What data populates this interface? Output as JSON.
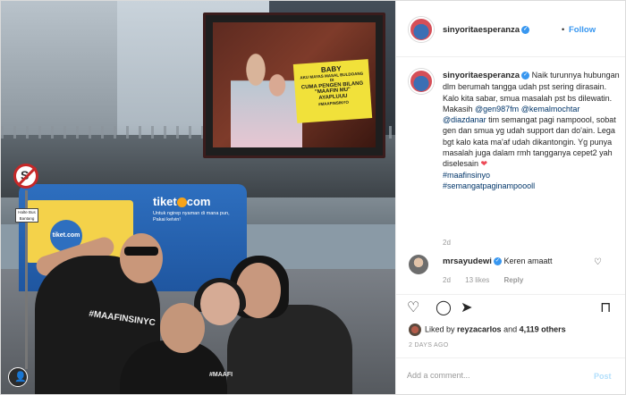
{
  "post": {
    "username": "sinyoritaesperanza",
    "follow_label": "Follow",
    "caption": {
      "text_1": "Naik turunnya hubungan dlm berumah tangga udah pst sering dirasain. Kalo kita sabar, smua masalah pst bs dilewatin. Makasih ",
      "mention_1": "@gen987fm",
      "mention_2": "@kemalmochtar",
      "mention_3": "@diazdanar",
      "text_2": " tim semangat pagi nampoool, sobat gen dan smua yg udah support dan do'ain. Lega bgt kalo kata ma'af udah dikantongin. Yg punya masalah juga dalam rmh tangganya cepet2 yah diselesain ",
      "hashtag_1": "#maafinsinyo",
      "hashtag_2": "#semangatpaginampoooll",
      "time": "2d"
    },
    "comment": {
      "username": "mrsayudewi",
      "text": "Keren amaatt",
      "time": "2d",
      "likes": "13 likes",
      "reply_label": "Reply"
    },
    "likes": {
      "prefix": "Liked by ",
      "user": "reyzacarlos",
      "middle": " and ",
      "count": "4,119 others"
    },
    "date": "2 DAYS AGO",
    "add_comment_placeholder": "Add a comment...",
    "post_label": "Post"
  },
  "photo": {
    "billboard_line_1": "BABY",
    "billboard_line_2": "AKU MAYAS MASAL BULDOANG DI",
    "billboard_line_3": "CUMA PENGEN BILANG",
    "billboard_line_4": "\"MAAFIN MU\"",
    "billboard_line_5": "AYAPLUUU",
    "billboard_line_6": "#MAAFINSINYO",
    "bus_brand": "tiket",
    "bus_brand_suffix": "com",
    "bus_tagline": "Untuk ngirep nyaman di mana pun, Pakai kelvin!",
    "bus_logo_small": "tiket.com",
    "halte_sign": "Halte Bus Bantang",
    "shirt_text_1": "#MAAFINSINYC",
    "shirt_text_2": "#MAAFI"
  },
  "icons": {
    "verified": "✓",
    "heart_red": "❤",
    "heart_outline": "♡",
    "comment": "◯",
    "share": "➤",
    "save": "⊓",
    "user": "👤"
  },
  "colors": {
    "link": "#003569",
    "follow": "#3897f0",
    "heart": "#ed4956"
  }
}
